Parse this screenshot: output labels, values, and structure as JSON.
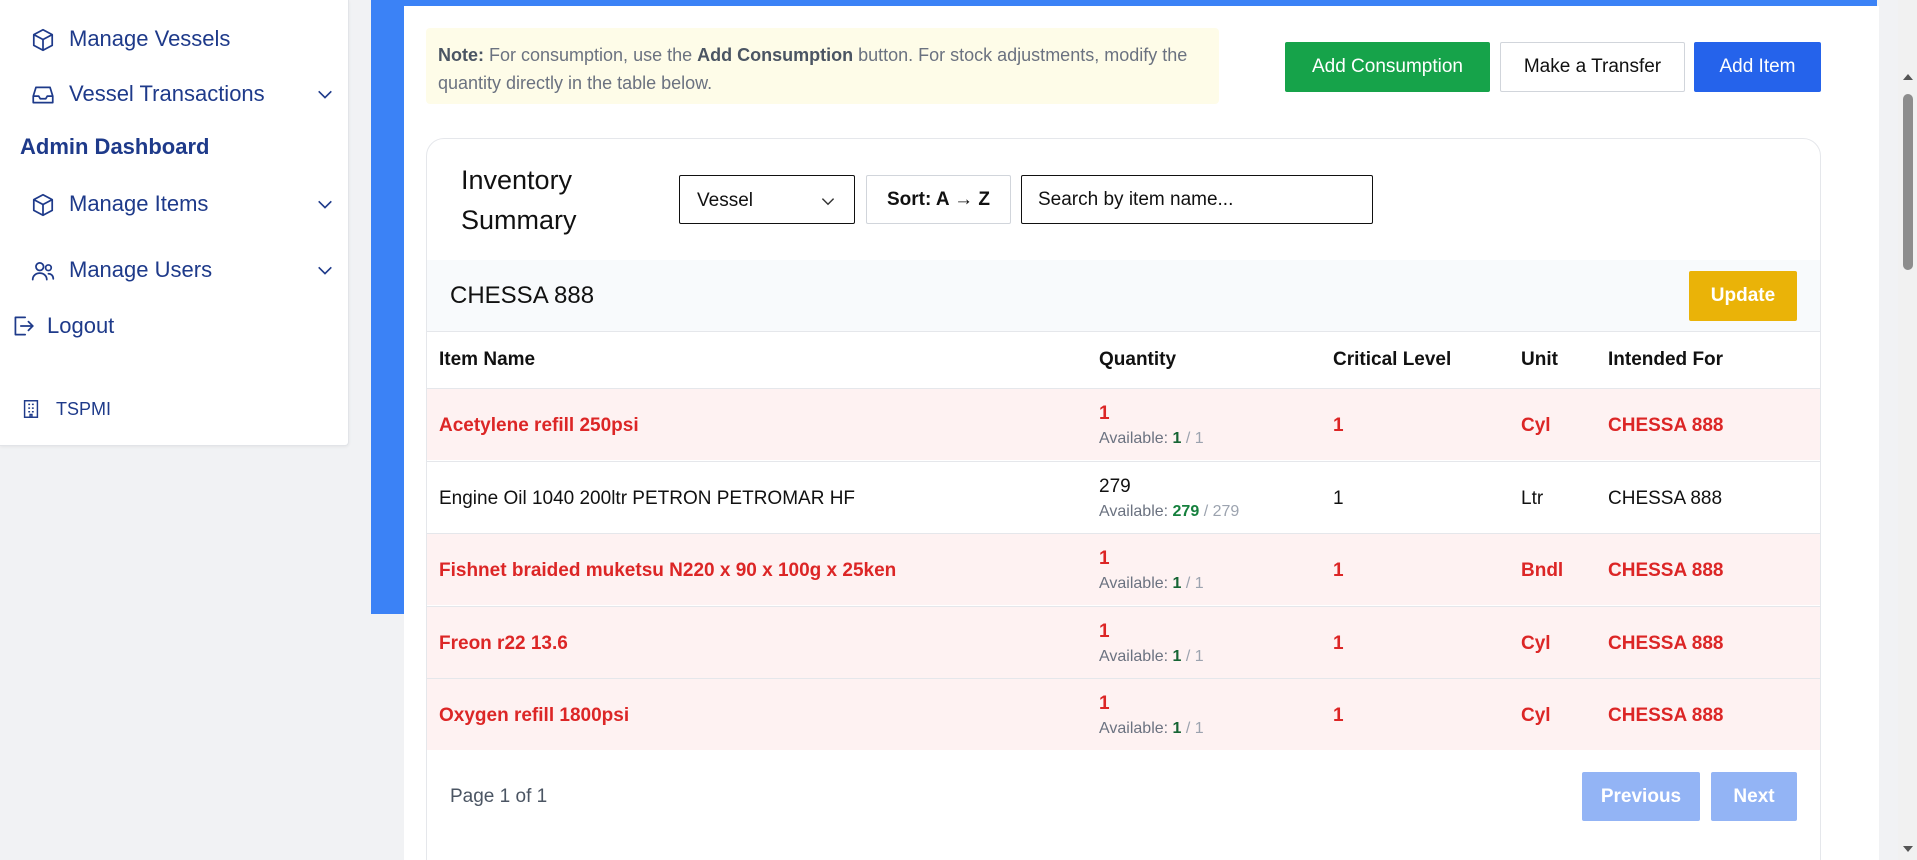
{
  "sidebar": {
    "items": [
      {
        "label": "Manage Vessels",
        "icon": "cube-icon",
        "expandable": false
      },
      {
        "label": "Vessel Transactions",
        "icon": "inbox-icon",
        "expandable": true
      }
    ],
    "admin_title": "Admin Dashboard",
    "admin_items": [
      {
        "label": "Manage Items",
        "icon": "cube-icon",
        "expandable": true
      },
      {
        "label": "Manage Users",
        "icon": "users-icon",
        "expandable": true
      }
    ],
    "logout_label": "Logout",
    "org_label": "TSPMI"
  },
  "note": {
    "prefix": "Note:",
    "text1": " For consumption, use the ",
    "bold": "Add Consumption",
    "text2": " button. For stock adjustments, modify the quantity directly in the table below."
  },
  "actions": {
    "add_consumption": "Add Consumption",
    "make_transfer": "Make a Transfer",
    "add_item": "Add Item"
  },
  "inventory": {
    "title_line1": "Inventory",
    "title_line2": "Summary",
    "filter_value": "Vessel",
    "sort_label": "Sort: A → Z",
    "search_placeholder": "Search by item name...",
    "vessel_name": "CHESSA 888",
    "update_label": "Update",
    "columns": {
      "item_name": "Item Name",
      "quantity": "Quantity",
      "critical_level": "Critical Level",
      "unit": "Unit",
      "intended_for": "Intended For"
    },
    "available_label": "Available: ",
    "rows": [
      {
        "name": "Acetylene refill 250psi",
        "qty": "1",
        "available": "1",
        "total": "/ 1",
        "critical": "1",
        "unit": "Cyl",
        "intended": "CHESSA 888",
        "low": true
      },
      {
        "name": "Engine Oil 1040 200ltr PETRON PETROMAR HF",
        "qty": "279",
        "available": "279",
        "total": "/ 279",
        "critical": "1",
        "unit": "Ltr",
        "intended": "CHESSA 888",
        "low": false
      },
      {
        "name": "Fishnet braided muketsu N220 x 90 x 100g x 25ken",
        "qty": "1",
        "available": "1",
        "total": "/ 1",
        "critical": "1",
        "unit": "Bndl",
        "intended": "CHESSA 888",
        "low": true
      },
      {
        "name": "Freon r22 13.6",
        "qty": "1",
        "available": "1",
        "total": "/ 1",
        "critical": "1",
        "unit": "Cyl",
        "intended": "CHESSA 888",
        "low": true
      },
      {
        "name": "Oxygen refill 1800psi",
        "qty": "1",
        "available": "1",
        "total": "/ 1",
        "critical": "1",
        "unit": "Cyl",
        "intended": "CHESSA 888",
        "low": true
      }
    ],
    "pagination": {
      "info": "Page 1 of 1",
      "previous": "Previous",
      "next": "Next"
    }
  },
  "colors": {
    "accent_blue": "#3b82f6",
    "nav_text": "#1e3a8a",
    "success": "#16a34a",
    "primary": "#2563eb",
    "warning": "#eab308",
    "danger": "#dc2626",
    "low_stock_bg": "#fef2f2"
  }
}
